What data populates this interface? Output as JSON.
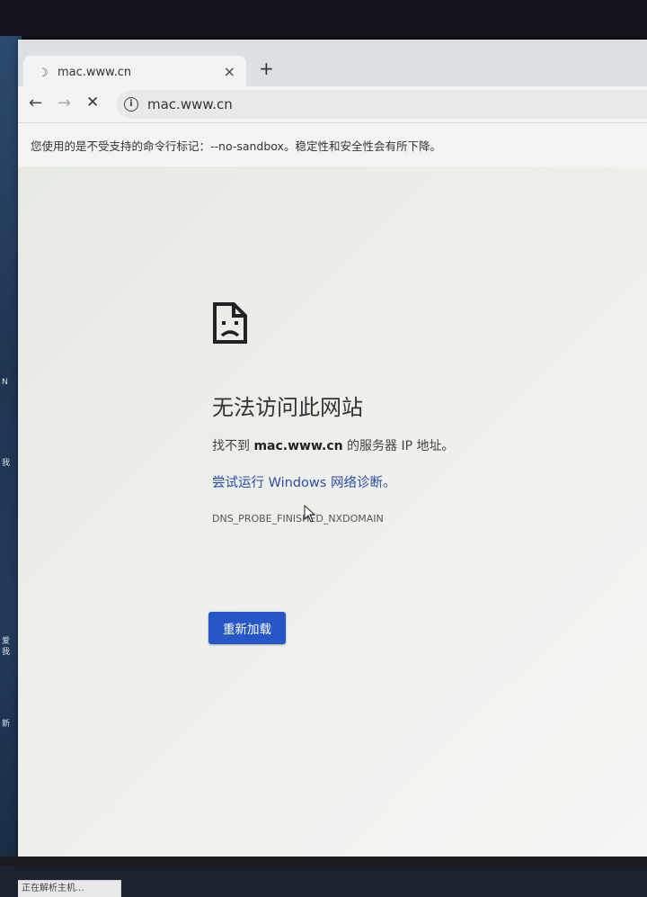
{
  "tab": {
    "title": "mac.www.cn",
    "spinner": "☽",
    "close": "×"
  },
  "new_tab": "+",
  "toolbar": {
    "back": "←",
    "forward": "→",
    "stop": "✕",
    "info": "i",
    "url": "mac.www.cn"
  },
  "infobar": {
    "message": "您使用的是不受支持的命令行标记：--no-sandbox。稳定性和安全性会有所下降。"
  },
  "error": {
    "title": "无法访问此网站",
    "desc_prefix": "找不到 ",
    "desc_host": "mac.www.cn",
    "desc_suffix": " 的服务器 IP 地址。",
    "diagnose_link": "尝试运行 Windows 网络诊断。",
    "code": "DNS_PROBE_FINISHED_NXDOMAIN",
    "reload_label": "重新加载"
  },
  "statusbar": {
    "text": "正在解析主机..."
  },
  "desktop": {
    "fragments": [
      "N",
      "我",
      "爱",
      "我",
      "新"
    ]
  },
  "icons": {
    "page": "sad-page-icon",
    "cursor": "mouse-pointer-icon"
  },
  "colors": {
    "link": "#2c4ca8",
    "button": "#2557c9"
  }
}
